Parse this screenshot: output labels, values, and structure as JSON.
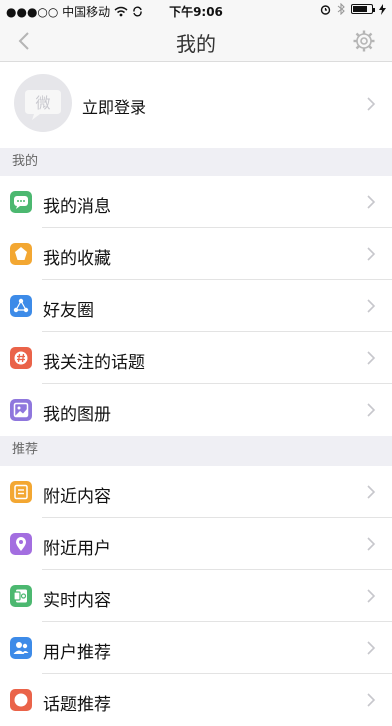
{
  "status_bar": {
    "signal_carrier": "●●●○○ 中国移动",
    "time": "下午9:06",
    "battery_percent": 80
  },
  "nav": {
    "title": "我的",
    "back_icon": "chevron-left-icon",
    "settings_icon": "gear-icon"
  },
  "login": {
    "avatar_text": "微",
    "label": "立即登录"
  },
  "sections": [
    {
      "header": "我的",
      "items": [
        {
          "label": "我的消息",
          "icon": "message-icon",
          "color": "#4cb870"
        },
        {
          "label": "我的收藏",
          "icon": "star-icon",
          "color": "#f3a732"
        },
        {
          "label": "好友圈",
          "icon": "friends-circle-icon",
          "color": "#3d8be8"
        },
        {
          "label": "我关注的话题",
          "icon": "hashtag-icon",
          "color": "#ea6349"
        },
        {
          "label": "我的图册",
          "icon": "album-icon",
          "color": "#8f77dd"
        }
      ]
    },
    {
      "header": "推荐",
      "items": [
        {
          "label": "附近内容",
          "icon": "nearby-content-icon",
          "color": "#f3a732"
        },
        {
          "label": "附近用户",
          "icon": "location-pin-icon",
          "color": "#a36ee0"
        },
        {
          "label": "实时内容",
          "icon": "realtime-icon",
          "color": "#4cb870"
        },
        {
          "label": "用户推荐",
          "icon": "user-recommend-icon",
          "color": "#3d8be8"
        },
        {
          "label": "话题推荐",
          "icon": "topic-recommend-icon",
          "color": "#ea6349"
        }
      ]
    }
  ]
}
